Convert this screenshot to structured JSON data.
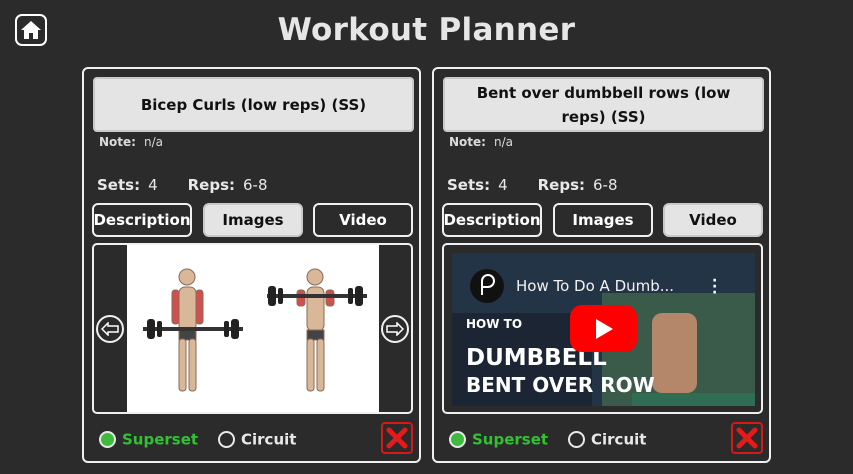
{
  "app": {
    "title": "Workout Planner",
    "home_icon": "home-icon"
  },
  "colors": {
    "background": "#2b2b2b",
    "superset_green": "#33c033",
    "delete_red": "#d81818",
    "youtube_red": "#ff0000"
  },
  "exercises": [
    {
      "name": "Bicep Curls (low reps) (SS)",
      "note_label": "Note:",
      "note_value": "n/a",
      "sets_label": "Sets:",
      "sets_value": "4",
      "reps_label": "Reps:",
      "reps_value": "6-8",
      "tabs": [
        "Description",
        "Images",
        "Video"
      ],
      "active_tab": "Images",
      "media_type": "image",
      "options": [
        "Superset",
        "Circuit"
      ],
      "selected_option": "Superset"
    },
    {
      "name": "Bent over dumbbell rows (low reps) (SS)",
      "note_label": "Note:",
      "note_value": "n/a",
      "sets_label": "Sets:",
      "sets_value": "4",
      "reps_label": "Reps:",
      "reps_value": "6-8",
      "tabs": [
        "Description",
        "Images",
        "Video"
      ],
      "active_tab": "Video",
      "media_type": "video",
      "video": {
        "title": "How To Do A Dumb...",
        "overlay_line1": "HOW TO",
        "overlay_line2": "DUMBBELL",
        "overlay_line3": "BENT OVER ROW"
      },
      "options": [
        "Superset",
        "Circuit"
      ],
      "selected_option": "Superset"
    }
  ]
}
